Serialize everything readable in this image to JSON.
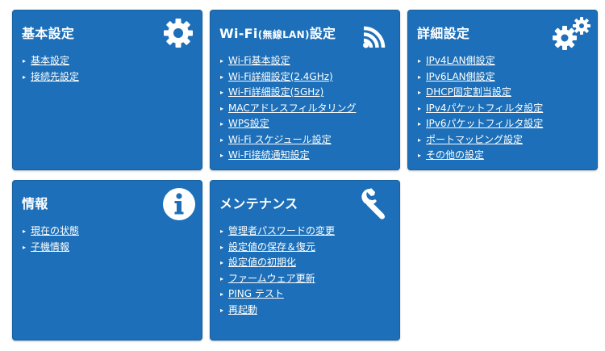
{
  "cards": [
    {
      "title": "基本設定",
      "icon": "gear-icon",
      "links": [
        "基本設定",
        "接続先設定"
      ]
    },
    {
      "title_main": "Wi-Fi",
      "title_small": "(無線LAN)",
      "title_suffix": "設定",
      "icon": "wifi-icon",
      "links": [
        "Wi-Fi基本設定",
        "Wi-Fi詳細設定(2.4GHz)",
        "Wi-Fi詳細設定(5GHz)",
        "MACアドレスフィルタリング",
        "WPS設定",
        "Wi-Fi スケジュール設定",
        "Wi-Fi接続通知設定"
      ]
    },
    {
      "title": "詳細設定",
      "icon": "gears-icon",
      "links": [
        "IPv4LAN側設定",
        "IPv6LAN側設定",
        "DHCP固定割当設定",
        "IPv4パケットフィルタ設定",
        "IPv6パケットフィルタ設定",
        "ポートマッピング設定",
        "その他の設定"
      ]
    },
    {
      "title": "情報",
      "icon": "info-icon",
      "links": [
        "現在の状態",
        "子機情報"
      ]
    },
    {
      "title": "メンテナンス",
      "icon": "wrench-icon",
      "links": [
        "管理者パスワードの変更",
        "設定値の保存＆復元",
        "設定値の初期化",
        "ファームウェア更新",
        "PING テスト",
        "再起動"
      ]
    }
  ],
  "colors": {
    "card_bg": "#1c6fb8",
    "text": "#ffffff"
  }
}
